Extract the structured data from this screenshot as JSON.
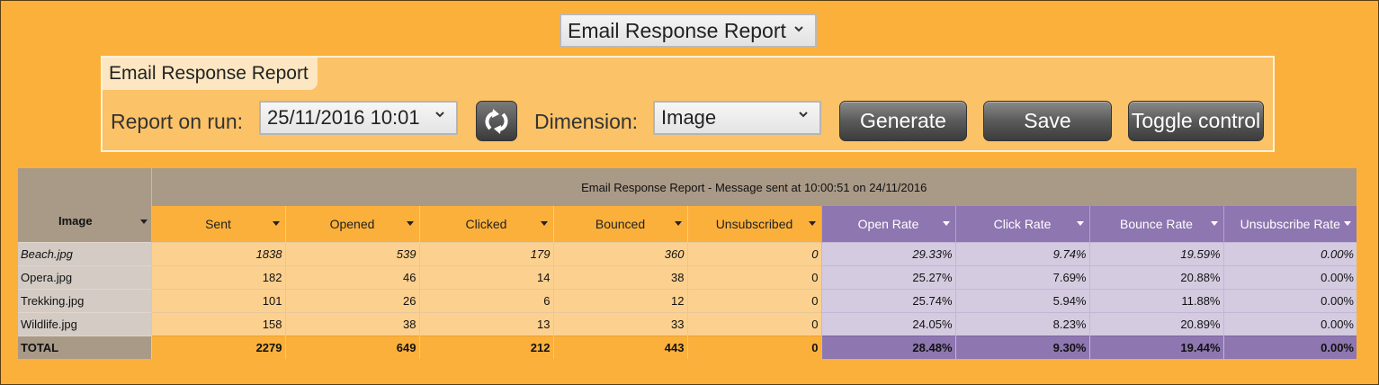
{
  "report_selector": {
    "value": "Email Response Report"
  },
  "panel": {
    "title": "Email Response Report",
    "report_on_run_label": "Report on run:",
    "report_on_run_value": "25/11/2016 10:01",
    "dimension_label": "Dimension:",
    "dimension_value": "Image",
    "generate_label": "Generate",
    "save_label": "Save",
    "toggle_label": "Toggle control"
  },
  "table": {
    "caption": "Email Response Report - Message sent at 10:00:51 on 24/11/2016",
    "row_header": "Image",
    "columns": [
      "Sent",
      "Opened",
      "Clicked",
      "Bounced",
      "Unsubscribed",
      "Open Rate",
      "Click Rate",
      "Bounce Rate",
      "Unsubscribe Rate"
    ],
    "rows": [
      {
        "name": "Beach.jpg",
        "values": [
          "1838",
          "539",
          "179",
          "360",
          "0",
          "29.33%",
          "9.74%",
          "19.59%",
          "0.00%"
        ]
      },
      {
        "name": "Opera.jpg",
        "values": [
          "182",
          "46",
          "14",
          "38",
          "0",
          "25.27%",
          "7.69%",
          "20.88%",
          "0.00%"
        ]
      },
      {
        "name": "Trekking.jpg",
        "values": [
          "101",
          "26",
          "6",
          "12",
          "0",
          "25.74%",
          "5.94%",
          "11.88%",
          "0.00%"
        ]
      },
      {
        "name": "Wildlife.jpg",
        "values": [
          "158",
          "38",
          "13",
          "33",
          "0",
          "24.05%",
          "8.23%",
          "20.89%",
          "0.00%"
        ]
      }
    ],
    "total": {
      "name": "TOTAL",
      "values": [
        "2279",
        "649",
        "212",
        "443",
        "0",
        "28.48%",
        "9.30%",
        "19.44%",
        "0.00%"
      ]
    }
  },
  "colors": {
    "background": "#fbb03b",
    "count_header": "#fbb03b",
    "rate_header": "#8e76b0",
    "row_header": "#a99987"
  },
  "icons": [
    "chevron-down-icon",
    "refresh-icon",
    "sort-arrow-icon"
  ]
}
